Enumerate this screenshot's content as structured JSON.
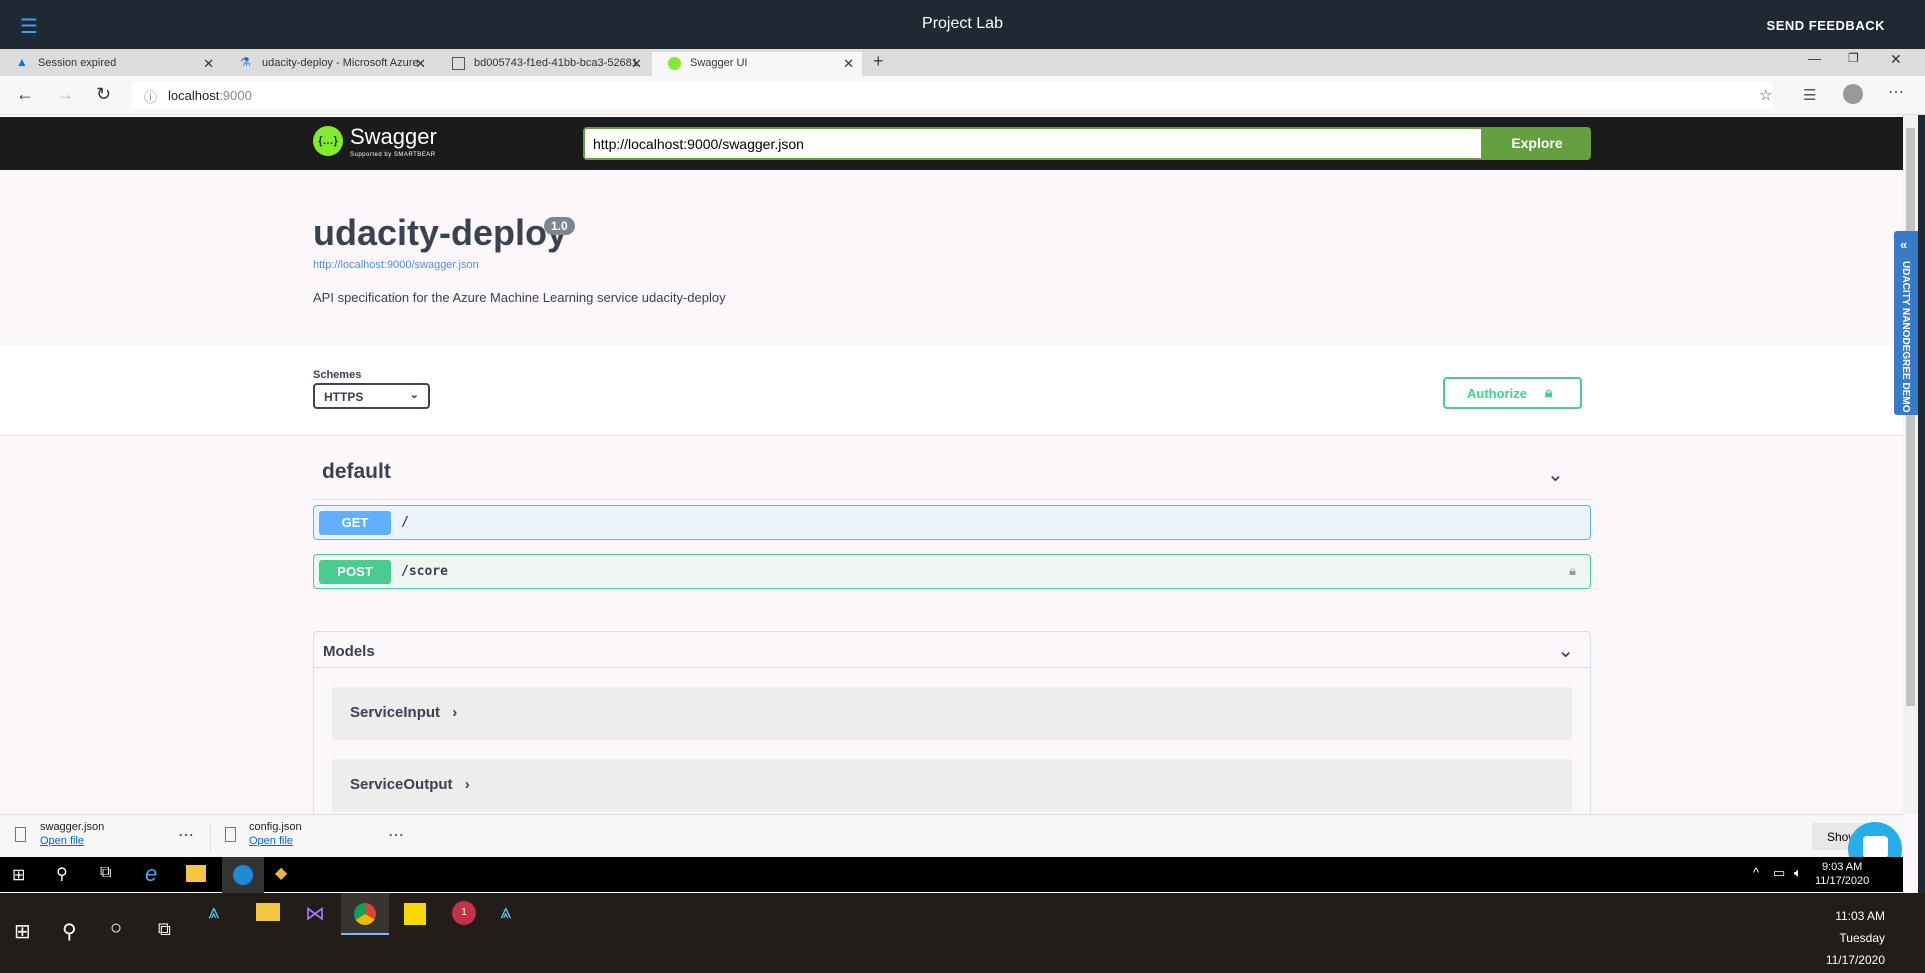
{
  "topbar": {
    "title": "Project Lab",
    "feedback": "SEND FEEDBACK"
  },
  "browser": {
    "tabs": [
      {
        "label": "Session expired"
      },
      {
        "label": "udacity-deploy - Microsoft Azure"
      },
      {
        "label": "bd005743-f1ed-41bb-bca3-52681"
      },
      {
        "label": "Swagger UI"
      }
    ],
    "url_host": "localhost",
    "url_port": ":9000"
  },
  "swagger": {
    "logo_text": "Swagger",
    "logo_sub": "Supported by SMARTBEAR",
    "spec_url": "http://localhost:9000/swagger.json",
    "explore": "Explore",
    "title": "udacity-deploy",
    "version": "1.0",
    "link": "http://localhost:9000/swagger.json",
    "description": "API specification for the Azure Machine Learning service udacity-deploy",
    "schemes_label": "Schemes",
    "scheme": "HTTPS",
    "authorize": "Authorize",
    "tag": "default",
    "operations": [
      {
        "method": "GET",
        "path": "/"
      },
      {
        "method": "POST",
        "path": "/score"
      }
    ],
    "models_title": "Models",
    "models": [
      "ServiceInput",
      "ServiceOutput"
    ]
  },
  "downloads": [
    {
      "name": "swagger.json",
      "action": "Open file"
    },
    {
      "name": "config.json",
      "action": "Open file"
    }
  ],
  "downloads_show": "Show",
  "side_tab": "UDACITY NANODEGREE DEMO",
  "inner_clock": {
    "time": "9:03 AM",
    "date": "11/17/2020"
  },
  "outer_clock": {
    "time": "11:03 AM",
    "day": "Tuesday",
    "date": "11/17/2020"
  },
  "colors": {
    "get": "#61affe",
    "post": "#49cc90",
    "explore": "#62a03f"
  }
}
